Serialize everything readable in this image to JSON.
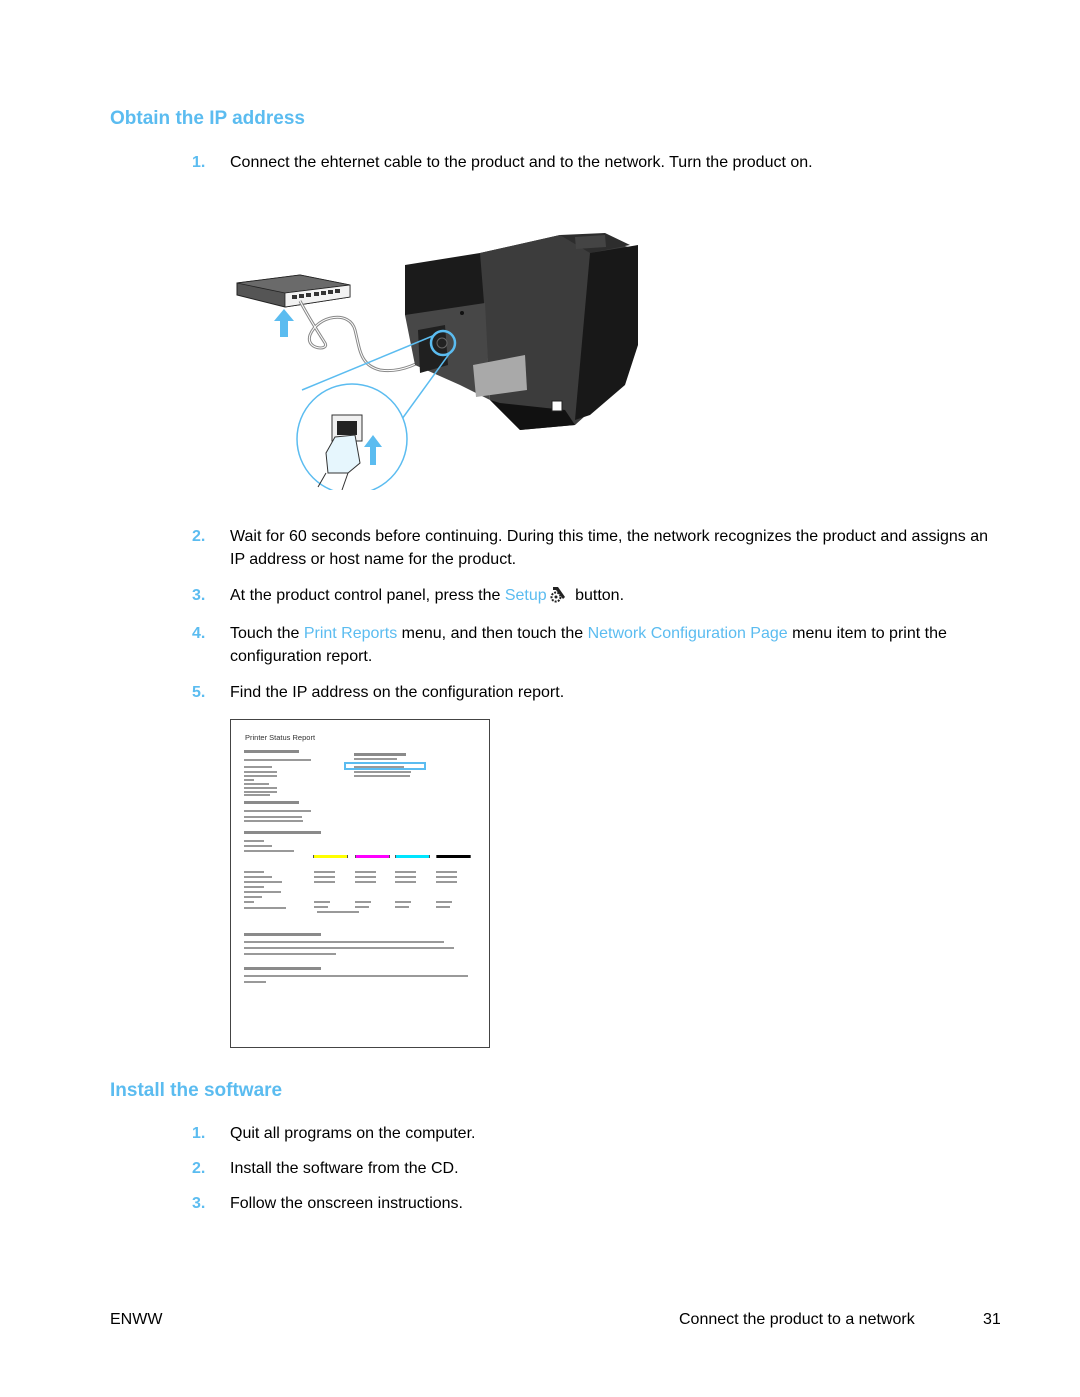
{
  "sections": [
    {
      "title": "Obtain the IP address",
      "steps": [
        {
          "num": "1.",
          "text": "Connect the ehternet cable to the product and to the network. Turn the product on."
        },
        {
          "num": "2.",
          "text": "Wait for 60 seconds before continuing. During this time, the network recognizes the product and assigns an IP address or host name for the product."
        },
        {
          "num": "3.",
          "text_before": "At the product control panel, press the ",
          "link": "Setup",
          "icon": "setup-wrench-gear-icon",
          "text_after": " button."
        },
        {
          "num": "4.",
          "text_before": "Touch the ",
          "link1": "Print Reports",
          "text_mid": " menu, and then touch the ",
          "link2": "Network Configuration Page",
          "text_after": " menu item to print the configuration report."
        },
        {
          "num": "5.",
          "text": "Find the IP address on the configuration report."
        }
      ]
    },
    {
      "title": "Install the software",
      "steps": [
        {
          "num": "1.",
          "text": "Quit all programs on the computer."
        },
        {
          "num": "2.",
          "text": "Install the software from the CD."
        },
        {
          "num": "3.",
          "text": "Follow the onscreen instructions."
        }
      ]
    }
  ],
  "figures": {
    "network_illustration": {
      "description": "Ethernet cable connecting network switch to printer rear port, with magnified RJ-45 port inset"
    },
    "report_sample": {
      "title": "Printer Status Report",
      "ink_colors": [
        "#ffff00",
        "#ff00ff",
        "#00e5ff",
        "#000000"
      ],
      "highlight_color": "#5bbcf0"
    }
  },
  "colors": {
    "accent": "#5bbcf0"
  },
  "footer": {
    "left": "ENWW",
    "section": "Connect the product to a network",
    "page": "31"
  }
}
